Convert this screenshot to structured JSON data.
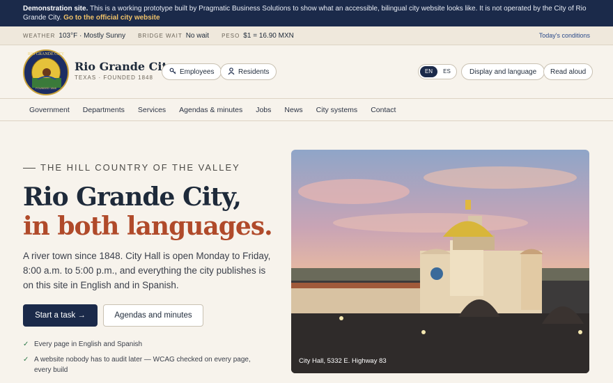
{
  "banner": {
    "strong": "Demonstration site.",
    "text": "This is a working prototype built by Pragmatic Business Solutions to show what an accessible, bilingual city website looks like. It is not operated by the City of Rio Grande City.",
    "link": "Go to the official city website"
  },
  "conditions": {
    "weather_label": "WEATHER",
    "weather_value": "103°F · Mostly Sunny",
    "bridge_label": "BRIDGE WAIT",
    "bridge_value": "No wait",
    "peso_label": "PESO",
    "peso_value": "$1 = 16.90 MXN",
    "today_link": "Today's conditions"
  },
  "header": {
    "seal_text": "RIO GRANDE CITY",
    "seal_foot": "FOUNDED 1848",
    "site_name": "Rio Grande City",
    "site_sub": "TEXAS · FOUNDED 1848",
    "employees": "Employees",
    "residents": "Residents",
    "lang_en": "EN",
    "lang_es": "ES",
    "display": "Display and language",
    "read_aloud": "Read aloud"
  },
  "nav": [
    "Government",
    "Departments",
    "Services",
    "Agendas & minutes",
    "Jobs",
    "News",
    "City systems",
    "Contact"
  ],
  "hero": {
    "eyebrow": "THE HILL COUNTRY OF THE VALLEY",
    "title_line1": "Rio Grande City,",
    "title_line2": "in both languages.",
    "lede": "A river town since 1848. City Hall is open Monday to Friday, 8:00 a.m. to 5:00 p.m., and everything the city publishes is on this site in English and in Spanish.",
    "primary_button": "Start a task →",
    "secondary_button": "Agendas and minutes",
    "checks": [
      "Every page in English and Spanish",
      "A website nobody has to audit later — WCAG checked on every page, every build"
    ],
    "photo_caption": "City Hall, 5332 E. Highway 83"
  },
  "colors": {
    "navy": "#1b2a4a",
    "accent": "#b04a2a",
    "background": "#f7f3ec"
  }
}
